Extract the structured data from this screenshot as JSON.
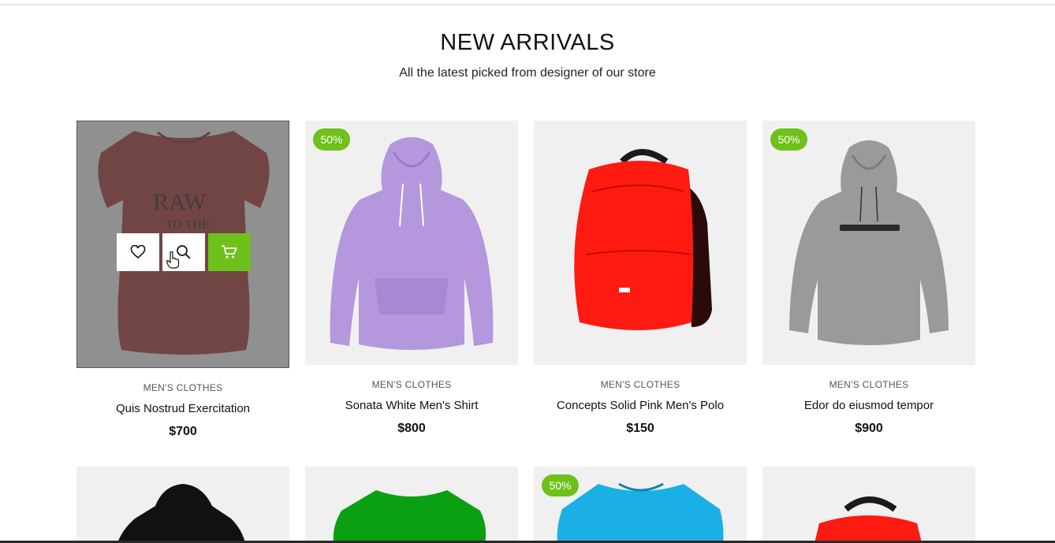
{
  "section": {
    "title": "NEW ARRIVALS",
    "subtitle": "All the latest picked from designer of our store"
  },
  "colors": {
    "accent": "#6ec01a",
    "thumb_bg": "#f0f0f0"
  },
  "products": [
    {
      "category": "MEN'S CLOTHES",
      "name": "Quis Nostrud Exercitation",
      "price": "$700",
      "badge": "",
      "image": "red-tshirt"
    },
    {
      "category": "MEN'S CLOTHES",
      "name": "Sonata White Men's Shirt",
      "price": "$800",
      "badge": "50%",
      "image": "lavender-hoodie"
    },
    {
      "category": "MEN'S CLOTHES",
      "name": "Concepts Solid Pink Men's Polo",
      "price": "$150",
      "badge": "",
      "image": "red-backpack"
    },
    {
      "category": "MEN'S CLOTHES",
      "name": "Edor do eiusmod tempor",
      "price": "$900",
      "badge": "50%",
      "image": "grey-hoodie"
    }
  ],
  "second_row": [
    {
      "badge": "",
      "image": "black-hoodie"
    },
    {
      "badge": "",
      "image": "green-tshirt"
    },
    {
      "badge": "50%",
      "image": "blue-tshirt"
    },
    {
      "badge": "",
      "image": "red-backpack"
    }
  ],
  "hover_actions": [
    "heart-icon",
    "search-icon",
    "cart-icon"
  ]
}
